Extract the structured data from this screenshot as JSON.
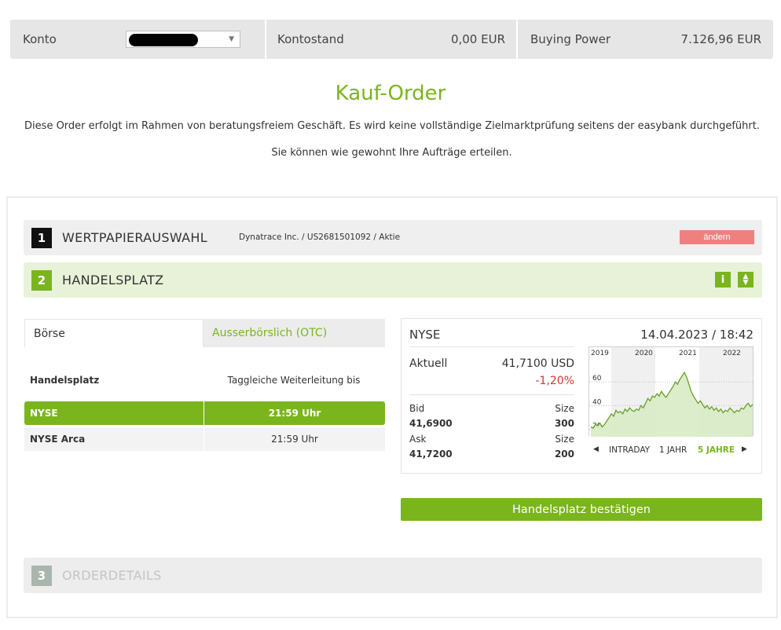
{
  "account_bar": {
    "konto_label": "Konto",
    "kontostand_label": "Kontostand",
    "kontostand_value": "0,00 EUR",
    "buying_power_label": "Buying Power",
    "buying_power_value": "7.126,96 EUR"
  },
  "header": {
    "title": "Kauf-Order",
    "line1": "Diese Order erfolgt im Rahmen von beratungsfreiem Geschäft. Es wird keine vollständige Zielmarktprüfung seitens der easybank durchgeführt.",
    "line2": "Sie können wie gewohnt Ihre Aufträge erteilen."
  },
  "steps": [
    {
      "number": "1",
      "name": "WERTPAPIERAUSWAHL",
      "security": "Dynatrace Inc. / US2681501092 / Aktie",
      "action": "ändern"
    },
    {
      "number": "2",
      "name": "HANDELSPLATZ"
    },
    {
      "number": "3",
      "name": "ORDERDETAILS"
    }
  ],
  "tabs": [
    {
      "label": "Börse",
      "active": true
    },
    {
      "label": "Ausserbörslich (OTC)",
      "active": false
    }
  ],
  "venue_table": {
    "headers": [
      "Handelsplatz",
      "Taggleiche Weiterleitung bis"
    ],
    "rows": [
      {
        "venue": "NYSE",
        "until": "21:59 Uhr",
        "selected": true
      },
      {
        "venue": "NYSE Arca",
        "until": "21:59 Uhr",
        "selected": false
      }
    ]
  },
  "quote": {
    "venue": "NYSE",
    "datetime": "14.04.2023 / 18:42",
    "aktuell_label": "Aktuell",
    "aktuell_value": "41,7100 USD",
    "change": "-1,20%",
    "bid_label": "Bid",
    "bid_value": "41,6900",
    "bid_size_label": "Size",
    "bid_size": "300",
    "ask_label": "Ask",
    "ask_value": "41,7200",
    "ask_size_label": "Size",
    "ask_size": "200"
  },
  "chart_nav": {
    "intraday": "INTRADAY",
    "one_year": "1 JAHR",
    "five_years": "5 JAHRE"
  },
  "chart_data": {
    "type": "area",
    "x_labels": [
      "2019",
      "2020",
      "2021",
      "2022"
    ],
    "y_ticks": [
      20,
      40,
      60
    ],
    "ylim": [
      15,
      80
    ],
    "series": [
      {
        "values": [
          22,
          21,
          24,
          23,
          25,
          22,
          24,
          27,
          30,
          33,
          31,
          36,
          34,
          35,
          33,
          37,
          35,
          38,
          36,
          35,
          37,
          36,
          40,
          38,
          42,
          46,
          44,
          48,
          47,
          50,
          48,
          52,
          49,
          47,
          50,
          53,
          56,
          60,
          58,
          62,
          65,
          68,
          64,
          58,
          52,
          48,
          45,
          42,
          44,
          41,
          38,
          40,
          37,
          39,
          36,
          38,
          35,
          37,
          34,
          36,
          35,
          38,
          36,
          34,
          36,
          35,
          38,
          37,
          40,
          42,
          39,
          41
        ]
      }
    ],
    "colors": {
      "line": "#6a9f2a",
      "fill": "#d7ebc4",
      "accent": "#7ab51d",
      "negative": "#e0322e"
    }
  },
  "confirm_button": "Handelsplatz bestätigen"
}
